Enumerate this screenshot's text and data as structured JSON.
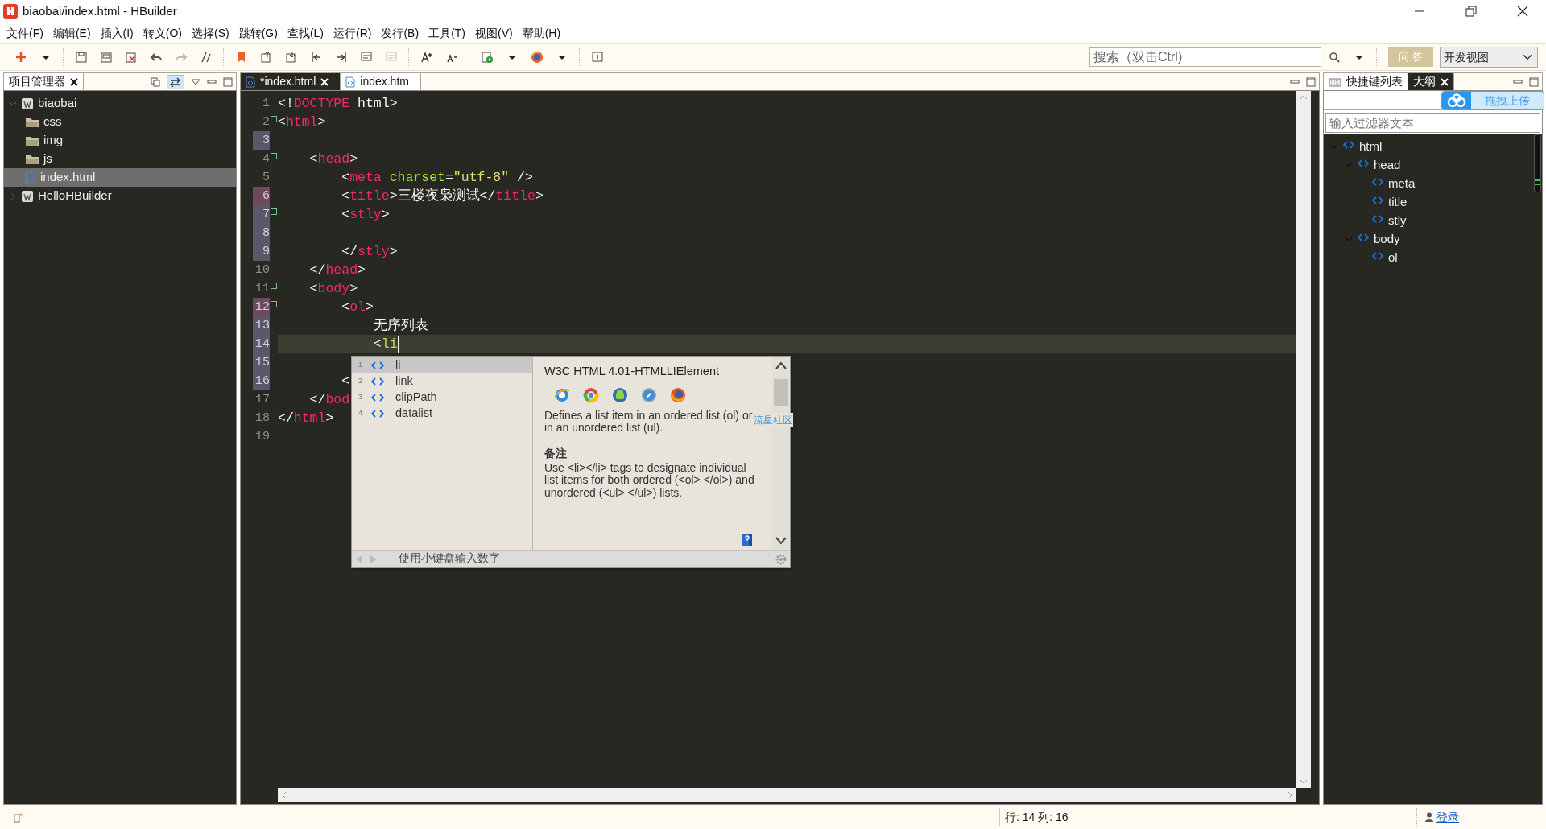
{
  "window": {
    "title": "biaobai/index.html  -  HBuilder"
  },
  "menu": [
    "文件(F)",
    "编辑(E)",
    "插入(I)",
    "转义(O)",
    "选择(S)",
    "跳转(G)",
    "查找(L)",
    "运行(R)",
    "发行(B)",
    "工具(T)",
    "视图(V)",
    "帮助(H)"
  ],
  "toolbar": {
    "search": {
      "placeholder": "搜索（双击Ctrl)"
    },
    "qa_button": "问 答",
    "perspective": "开发视图"
  },
  "project_panel": {
    "title": "项目管理器",
    "tree": [
      {
        "label": "biaobai",
        "kind": "project",
        "expanded": true,
        "selected": false,
        "children": [
          {
            "label": "css",
            "kind": "folder",
            "selected": false
          },
          {
            "label": "img",
            "kind": "folder",
            "selected": false
          },
          {
            "label": "js",
            "kind": "folder",
            "selected": false
          },
          {
            "label": "index.html",
            "kind": "file",
            "selected": true
          }
        ]
      },
      {
        "label": "HelloHBuilder",
        "kind": "project",
        "expanded": false,
        "selected": false
      }
    ]
  },
  "editor": {
    "tabs": [
      {
        "label": "*index.html",
        "selected": true,
        "closable": true
      },
      {
        "label": "index.htm",
        "selected": false,
        "closable": false
      }
    ],
    "lines": [
      {
        "number": "1",
        "fold": false,
        "current": false,
        "tokens": [
          {
            "kind": "punct",
            "text": "<!"
          },
          {
            "kind": "tag",
            "text": "DOCTYPE"
          },
          {
            "kind": "punct",
            "text": " html>"
          }
        ]
      },
      {
        "number": "2",
        "fold": true,
        "current": false,
        "tokens": [
          {
            "kind": "punct",
            "text": "<"
          },
          {
            "kind": "tag",
            "text": "html"
          },
          {
            "kind": "punct",
            "text": ">"
          }
        ]
      },
      {
        "number": "3",
        "fold": false,
        "current": false,
        "change_marker": {
          "color": "#5b5768"
        }
      },
      {
        "number": "4",
        "fold": true,
        "current": false,
        "tokens": [
          {
            "kind": "punct",
            "text": "    <"
          },
          {
            "kind": "tag",
            "text": "head"
          },
          {
            "kind": "punct",
            "text": ">"
          }
        ]
      },
      {
        "number": "5",
        "fold": false,
        "current": false,
        "tokens": [
          {
            "kind": "punct",
            "text": "        <"
          },
          {
            "kind": "tag",
            "text": "meta"
          },
          {
            "kind": "attr",
            "text": " charset"
          },
          {
            "kind": "punct",
            "text": "="
          },
          {
            "kind": "string",
            "text": "\"utf-8\""
          },
          {
            "kind": "punct",
            "text": " />"
          }
        ]
      },
      {
        "number": "6",
        "fold": false,
        "current": false,
        "change_marker": {
          "color": "#6d4a5c"
        },
        "tokens": [
          {
            "kind": "punct",
            "text": "        <"
          },
          {
            "kind": "tag",
            "text": "title"
          },
          {
            "kind": "punct",
            "text": ">"
          },
          {
            "kind": "text",
            "text": "三楼夜枭测试"
          },
          {
            "kind": "punct",
            "text": "</"
          },
          {
            "kind": "tag",
            "text": "title"
          },
          {
            "kind": "punct",
            "text": ">"
          }
        ]
      },
      {
        "number": "7",
        "fold": true,
        "current": false,
        "change_marker": {
          "color": "#5b5768"
        },
        "tokens": [
          {
            "kind": "punct",
            "text": "        <"
          },
          {
            "kind": "tag",
            "text": "stly"
          },
          {
            "kind": "punct",
            "text": ">"
          }
        ]
      },
      {
        "number": "8",
        "fold": false,
        "current": false,
        "change_marker": {
          "color": "#5b5768"
        }
      },
      {
        "number": "9",
        "fold": false,
        "current": false,
        "change_marker": {
          "color": "#5b5768"
        },
        "tokens": [
          {
            "kind": "punct",
            "text": "        </"
          },
          {
            "kind": "tag",
            "text": "stly"
          },
          {
            "kind": "punct",
            "text": ">"
          }
        ]
      },
      {
        "number": "10",
        "fold": false,
        "current": false,
        "tokens": [
          {
            "kind": "punct",
            "text": "    </"
          },
          {
            "kind": "tag",
            "text": "head"
          },
          {
            "kind": "punct",
            "text": ">"
          }
        ]
      },
      {
        "number": "11",
        "fold": true,
        "current": false,
        "tokens": [
          {
            "kind": "punct",
            "text": "    <"
          },
          {
            "kind": "tag",
            "text": "body"
          },
          {
            "kind": "punct",
            "text": ">"
          }
        ]
      },
      {
        "number": "12",
        "fold": true,
        "current": false,
        "change_marker": {
          "color": "#6d4a5c"
        },
        "tokens": [
          {
            "kind": "punct",
            "text": "        <"
          },
          {
            "kind": "tag",
            "text": "ol"
          },
          {
            "kind": "punct",
            "text": ">"
          }
        ]
      },
      {
        "number": "13",
        "fold": false,
        "current": false,
        "change_marker": {
          "color": "#5b5768"
        },
        "tokens": [
          {
            "kind": "text",
            "text": "            无序列表"
          }
        ]
      },
      {
        "number": "14",
        "fold": false,
        "current": true,
        "change_marker": {
          "color": "#5b5768"
        },
        "tokens": [
          {
            "kind": "punct",
            "text": "            <"
          },
          {
            "kind": "typing",
            "text": "li"
          }
        ]
      },
      {
        "number": "15",
        "fold": false,
        "current": false,
        "change_marker": {
          "color": "#5b5768"
        }
      },
      {
        "number": "16",
        "fold": false,
        "current": false,
        "change_marker": {
          "color": "#5b5768"
        },
        "tokens": [
          {
            "kind": "punct",
            "text": "        <"
          }
        ]
      },
      {
        "number": "17",
        "fold": false,
        "current": false,
        "tokens": [
          {
            "kind": "punct",
            "text": "    </"
          },
          {
            "kind": "tag",
            "text": "bod"
          }
        ]
      },
      {
        "number": "18",
        "fold": false,
        "current": false,
        "tokens": [
          {
            "kind": "punct",
            "text": "</"
          },
          {
            "kind": "tag",
            "text": "html"
          },
          {
            "kind": "punct",
            "text": ">"
          }
        ]
      },
      {
        "number": "19",
        "fold": false,
        "current": false
      }
    ]
  },
  "autocomplete": {
    "items": [
      {
        "index": "1",
        "label": "li",
        "selected": true
      },
      {
        "index": "2",
        "label": "link",
        "selected": false
      },
      {
        "index": "3",
        "label": "clipPath",
        "selected": false
      },
      {
        "index": "4",
        "label": "datalist",
        "selected": false
      }
    ],
    "doc": {
      "title": "W3C HTML 4.01-HTMLLIElement",
      "description": "Defines a list item in an ordered list (ol) or in an unordered list (ul).",
      "note_heading": "备注",
      "note": "Use <li></li> tags to designate individual list items for both ordered (<ol> </ol>) and unordered (<ul> </ul>) lists."
    },
    "hint": "使用小键盘输入数字"
  },
  "community_link": "流星社区",
  "right_panel": {
    "tabs": [
      {
        "label": "快捷键列表",
        "selected": false
      },
      {
        "label": "大纲",
        "selected": true
      }
    ],
    "filter": {
      "placeholder": "输入过滤器文本"
    },
    "outline": [
      {
        "label": "html",
        "expanded": true,
        "children": [
          {
            "label": "head",
            "expanded": true,
            "children": [
              {
                "label": "meta"
              },
              {
                "label": "title"
              },
              {
                "label": "stly"
              }
            ]
          },
          {
            "label": "body",
            "expanded": true,
            "children": [
              {
                "label": "ol"
              }
            ]
          }
        ]
      }
    ]
  },
  "upload_widget": {
    "label": "拖拽上传"
  },
  "status_bar": {
    "position": "行: 14 列: 16",
    "login": "登录"
  }
}
